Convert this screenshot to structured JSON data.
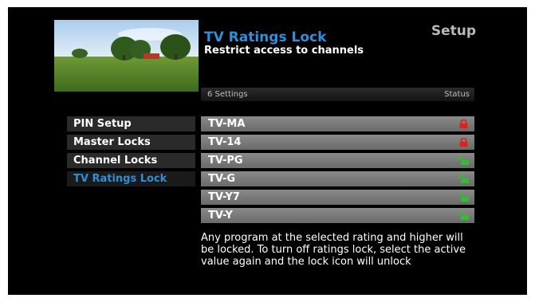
{
  "header": {
    "title": "TV Ratings Lock",
    "subtitle": "Restrict access to channels",
    "screen_name": "Setup"
  },
  "table_header": {
    "count": "6 Settings",
    "status": "Status"
  },
  "menu": {
    "items": [
      {
        "label": "PIN Setup"
      },
      {
        "label": "Master Locks"
      },
      {
        "label": "Channel Locks"
      },
      {
        "label": "TV Ratings Lock",
        "active": true
      }
    ]
  },
  "ratings": [
    {
      "label": "TV-MA",
      "status": "locked",
      "icon": "lock-closed-icon"
    },
    {
      "label": "TV-14",
      "status": "locked",
      "icon": "lock-closed-icon"
    },
    {
      "label": "TV-PG",
      "status": "unlocked",
      "icon": "lock-open-icon"
    },
    {
      "label": "TV-G",
      "status": "unlocked",
      "icon": "lock-open-icon"
    },
    {
      "label": "TV-Y7",
      "status": "unlocked",
      "icon": "lock-open-icon"
    },
    {
      "label": "TV-Y",
      "status": "unlocked",
      "icon": "lock-open-icon"
    }
  ],
  "info_text": "Any program at the selected rating and higher will be locked. To turn off ratings lock, select the active value again and the lock icon will unlock",
  "colors": {
    "accent": "#2f8fd8",
    "locked": "#e0201b",
    "unlocked": "#2fbf2f"
  }
}
